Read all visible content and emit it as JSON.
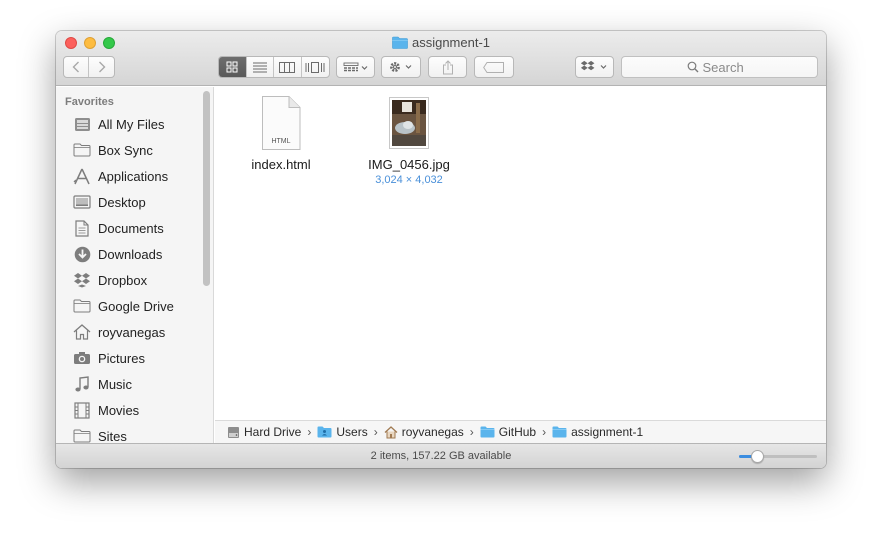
{
  "window": {
    "title": "assignment-1"
  },
  "toolbar": {
    "view_modes": [
      "icon-view",
      "list-view",
      "column-view",
      "cover-flow-view"
    ],
    "active_view": 0,
    "search": {
      "placeholder": "Search",
      "value": ""
    }
  },
  "sidebar": {
    "heading": "Favorites",
    "items": [
      {
        "label": "All My Files",
        "icon": "all-files-icon"
      },
      {
        "label": "Box Sync",
        "icon": "folder-icon"
      },
      {
        "label": "Applications",
        "icon": "applications-icon"
      },
      {
        "label": "Desktop",
        "icon": "desktop-icon"
      },
      {
        "label": "Documents",
        "icon": "documents-icon"
      },
      {
        "label": "Downloads",
        "icon": "downloads-icon"
      },
      {
        "label": "Dropbox",
        "icon": "dropbox-icon"
      },
      {
        "label": "Google Drive",
        "icon": "folder-icon"
      },
      {
        "label": "royvanegas",
        "icon": "home-icon"
      },
      {
        "label": "Pictures",
        "icon": "camera-icon"
      },
      {
        "label": "Music",
        "icon": "music-icon"
      },
      {
        "label": "Movies",
        "icon": "movies-icon"
      },
      {
        "label": "Sites",
        "icon": "folder-icon"
      }
    ]
  },
  "files": [
    {
      "name": "index.html",
      "type_label": "HTML",
      "subtitle": ""
    },
    {
      "name": "IMG_0456.jpg",
      "type_label": "",
      "subtitle": "3,024 × 4,032"
    }
  ],
  "pathbar": [
    {
      "label": "Hard Drive",
      "icon": "hard-drive-icon"
    },
    {
      "label": "Users",
      "icon": "users-folder-icon"
    },
    {
      "label": "royvanegas",
      "icon": "home-icon"
    },
    {
      "label": "GitHub",
      "icon": "folder-icon"
    },
    {
      "label": "assignment-1",
      "icon": "folder-icon"
    }
  ],
  "status": {
    "text": "2 items, 157.22 GB available",
    "icon_size_fraction": 0.23
  },
  "colors": {
    "accent": "#3b8de0",
    "folder": "#5ab4ec",
    "close": "#fc605c",
    "minimize": "#fdbc40",
    "zoom": "#34c84a"
  }
}
